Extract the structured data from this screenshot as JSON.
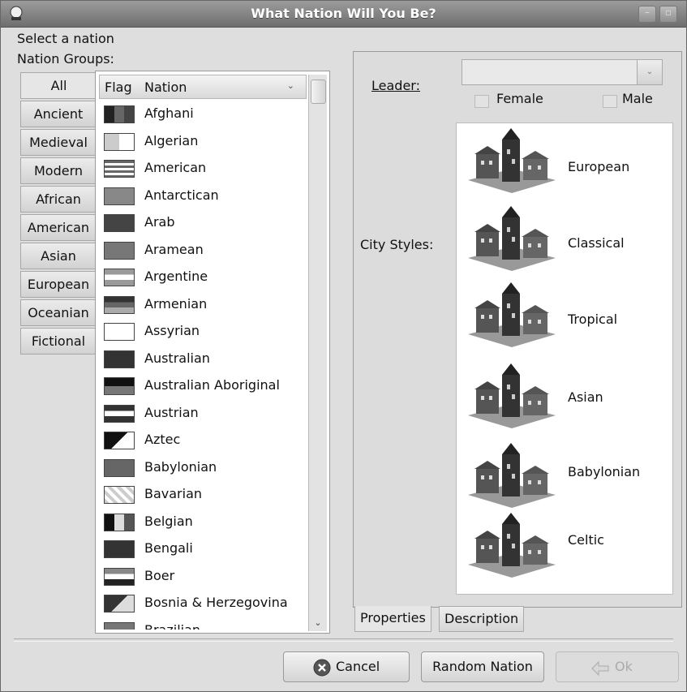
{
  "window": {
    "title": "What Nation Will You Be?"
  },
  "labels": {
    "select_nation": "Select a nation",
    "nation_groups": "Nation Groups:",
    "leader": "Leader:",
    "female": "Female",
    "male": "Male",
    "city_styles": "City Styles:"
  },
  "groups": [
    "All",
    "Ancient",
    "Medieval",
    "Modern",
    "African",
    "American",
    "Asian",
    "European",
    "Oceanian",
    "Fictional"
  ],
  "list": {
    "columns": [
      "Flag",
      "Nation"
    ],
    "nations": [
      "Afghani",
      "Algerian",
      "American",
      "Antarctican",
      "Arab",
      "Aramean",
      "Argentine",
      "Armenian",
      "Assyrian",
      "Australian",
      "Australian Aboriginal",
      "Austrian",
      "Aztec",
      "Babylonian",
      "Bavarian",
      "Belgian",
      "Bengali",
      "Boer",
      "Bosnia & Herzegovina",
      "Brazilian"
    ]
  },
  "city_styles": [
    "European",
    "Classical",
    "Tropical",
    "Asian",
    "Babylonian",
    "Celtic"
  ],
  "tabs": [
    "Properties",
    "Description"
  ],
  "buttons": {
    "cancel": "Cancel",
    "random": "Random Nation",
    "ok": "Ok"
  }
}
